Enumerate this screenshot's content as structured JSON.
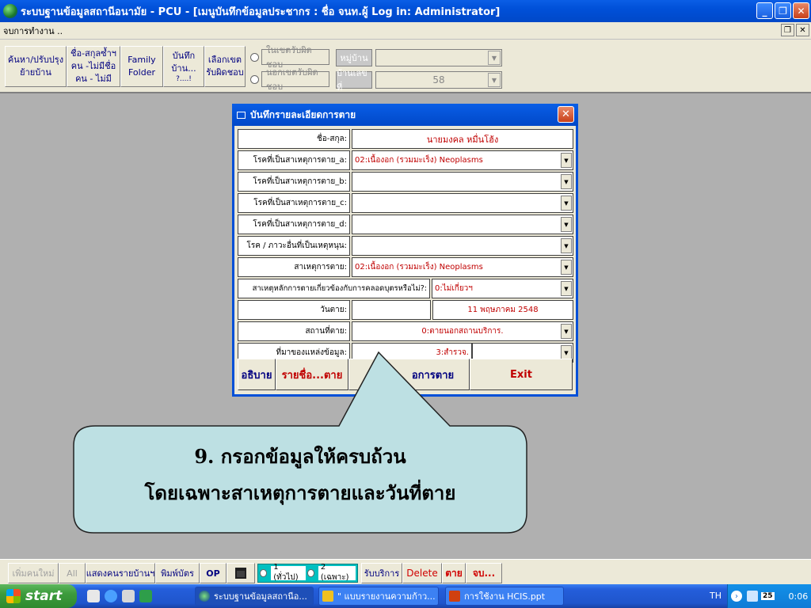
{
  "window": {
    "title": "ระบบฐานข้อมูลสถานีอนามัย - PCU - [เมนูบันทึกข้อมูลประชากร : ชื่อ จนท.ผู้ Log in: Administrator]",
    "minimize": "_",
    "restore": "❐",
    "close": "✕"
  },
  "menubar": {
    "item": "จบการทำงาน ..",
    "restore": "❐",
    "close": "✕"
  },
  "toolbar": {
    "btn_search": [
      "ค้นหา/ปรับปรุง",
      "ย้ายบ้าน"
    ],
    "btn_name": [
      "ชื่อ-สกุลซ้ำฯ",
      "คน -ไม่มีชื่อ",
      "คน - ไม่มี"
    ],
    "btn_family": [
      "Family",
      "Folder"
    ],
    "btn_house": [
      "บันทึก",
      "บ้าน...",
      "?....!"
    ],
    "btn_zone": [
      "เลือกเขต",
      "รับผิดชอบ"
    ],
    "radio_in": "ในเขตรับผิดชอบ",
    "radio_out": "นอกเขตรับผิดชอบ",
    "village_label": "หมู่บ้าน",
    "house_no_label": "บ้านเลขที่",
    "village_value": "",
    "house_no_value": "58",
    "dropdown": "▼"
  },
  "dialog": {
    "title": "บันทึกรายละเอียดการตาย",
    "close": "✕",
    "dropdown": "▼",
    "fields": [
      {
        "label": "ชื่อ-สกุล:",
        "value": "นายมงคล  หมื่นโฮ้ง"
      },
      {
        "label": "โรคที่เป็นสาเหตุการตาย_a:",
        "value": "02:เนื้องอก (รวมมะเร็ง)  Neoplasms"
      },
      {
        "label": "โรคที่เป็นสาเหตุการตาย_b:",
        "value": ""
      },
      {
        "label": "โรคที่เป็นสาเหตุการตาย_c:",
        "value": ""
      },
      {
        "label": "โรคที่เป็นสาเหตุการตาย_d:",
        "value": ""
      },
      {
        "label": "โรค / ภาวะอื่นที่เป็นเหตุหนุน:",
        "value": ""
      },
      {
        "label": "สาเหตุการตาย:",
        "value": "02:เนื้องอก (รวมมะเร็ง)  Neoplasms"
      },
      {
        "label": "สาเหตุหลักการตายเกี่ยวข้องกับการคลอดบุตรหรือไม่?:",
        "value": "0:ไม่เกี่ยวฯ"
      },
      {
        "label": "วันตาย:",
        "value": "",
        "value2": "11 พฤษภาคม 2548"
      },
      {
        "label": "สถานที่ตาย:",
        "value": "0:ตายนอกสถานบริการ."
      },
      {
        "label": "ที่มาของแหล่งข้อมูล:",
        "value": "3:สำรวจ."
      }
    ],
    "btn_explain": "อธิบาย",
    "btn_list": "รายชื่อ...ตาย",
    "btn_cancel": "อการตาย",
    "btn_exit": "Exit"
  },
  "callout": {
    "line1": "9. กรอกข้อมูลให้ครบถ้วน",
    "line2": "โดยเฉพาะสาเหตุการตายและวันที่ตาย"
  },
  "bottombar": {
    "add": "เพิ่มคนใหม่",
    "all": "All",
    "show": "แสดงคนรายบ้านฯ",
    "print": "พิมพ์บัตร",
    "op": "OP",
    "opt1": "1 (ทั่วไป)",
    "opt2": "2 (เฉพาะ)",
    "service": "รับบริการ",
    "delete": "Delete",
    "death": "ตาย",
    "end": "จบ..."
  },
  "taskbar": {
    "start": "start",
    "task1": "ระบบฐานข้อมูลสถานีอ...",
    "task2": "\" แบบรายงานความก้าว...",
    "task3": "การใช้งาน HCIS.ppt",
    "lang": "TH",
    "time": "0:06",
    "tray_badge": "25"
  }
}
